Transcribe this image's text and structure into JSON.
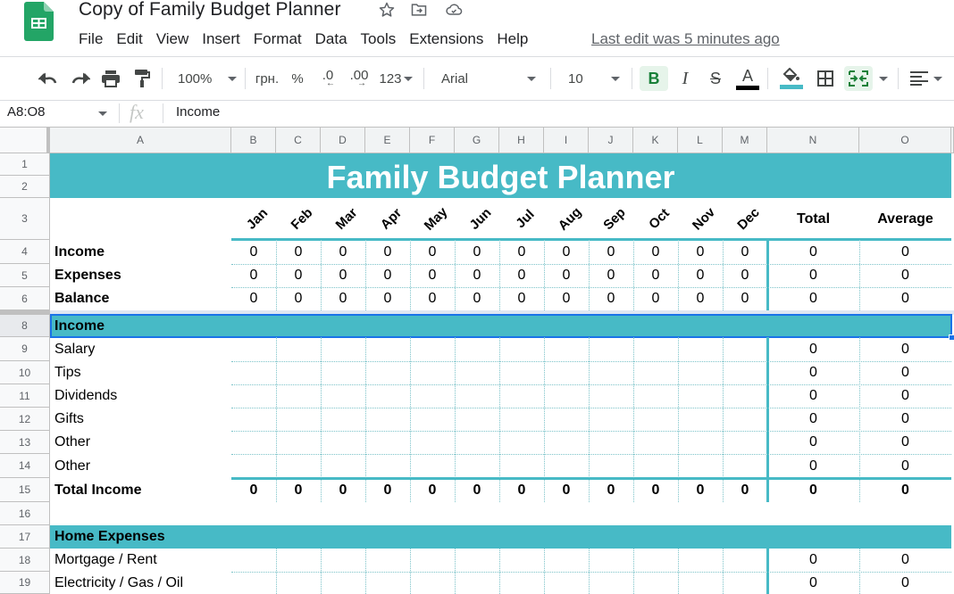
{
  "app": {
    "title": "Copy of Family Budget Planner",
    "title_icons": [
      "star-icon",
      "move-folder-icon",
      "cloud-saved-icon"
    ],
    "menu": [
      "File",
      "Edit",
      "View",
      "Insert",
      "Format",
      "Data",
      "Tools",
      "Extensions",
      "Help"
    ],
    "last_edit": "Last edit was 5 minutes ago"
  },
  "toolbar": {
    "zoom": "100%",
    "currency": "грн.",
    "percent": "%",
    "decrease_decimal": ".0",
    "increase_decimal": ".00",
    "more_formats": "123",
    "font": "Arial",
    "font_size": "10",
    "bold": "B",
    "italic": "I",
    "strikethrough": "S",
    "text_color_label": "A",
    "text_color": "#000000",
    "fill_color": "#47bac6"
  },
  "formula_bar": {
    "name_box": "A8:O8",
    "fx": "fx",
    "value": "Income"
  },
  "sheet": {
    "columns": [
      "A",
      "B",
      "C",
      "D",
      "E",
      "F",
      "G",
      "H",
      "I",
      "J",
      "K",
      "L",
      "M",
      "N",
      "O"
    ],
    "row_numbers": [
      "1",
      "2",
      "3",
      "4",
      "5",
      "6",
      "8",
      "9",
      "10",
      "11",
      "12",
      "13",
      "14",
      "15",
      "16",
      "17",
      "18",
      "19"
    ],
    "title": "Family Budget Planner",
    "months": [
      "Jan",
      "Feb",
      "Mar",
      "Apr",
      "May",
      "Jun",
      "Jul",
      "Aug",
      "Sep",
      "Oct",
      "Nov",
      "Dec"
    ],
    "total_header": "Total",
    "average_header": "Average",
    "summary_rows": [
      {
        "label": "Income",
        "values": [
          "0",
          "0",
          "0",
          "0",
          "0",
          "0",
          "0",
          "0",
          "0",
          "0",
          "0",
          "0"
        ],
        "total": "0",
        "average": "0"
      },
      {
        "label": "Expenses",
        "values": [
          "0",
          "0",
          "0",
          "0",
          "0",
          "0",
          "0",
          "0",
          "0",
          "0",
          "0",
          "0"
        ],
        "total": "0",
        "average": "0"
      },
      {
        "label": "Balance",
        "values": [
          "0",
          "0",
          "0",
          "0",
          "0",
          "0",
          "0",
          "0",
          "0",
          "0",
          "0",
          "0"
        ],
        "total": "0",
        "average": "0"
      }
    ],
    "income_section": {
      "header": "Income",
      "items": [
        {
          "label": "Salary",
          "total": "0",
          "average": "0"
        },
        {
          "label": "Tips",
          "total": "0",
          "average": "0"
        },
        {
          "label": "Dividends",
          "total": "0",
          "average": "0"
        },
        {
          "label": "Gifts",
          "total": "0",
          "average": "0"
        },
        {
          "label": "Other",
          "total": "0",
          "average": "0"
        },
        {
          "label": "Other",
          "total": "0",
          "average": "0"
        }
      ],
      "total_label": "Total Income",
      "total_values": [
        "0",
        "0",
        "0",
        "0",
        "0",
        "0",
        "0",
        "0",
        "0",
        "0",
        "0",
        "0"
      ],
      "total_total": "0",
      "total_average": "0"
    },
    "home_section": {
      "header": "Home Expenses",
      "items": [
        {
          "label": "Mortgage / Rent",
          "total": "0",
          "average": "0"
        },
        {
          "label": "Electricity / Gas / Oil",
          "total": "0",
          "average": "0"
        }
      ]
    },
    "accent_color": "#47bac6",
    "selection_color": "#1a73e8"
  }
}
